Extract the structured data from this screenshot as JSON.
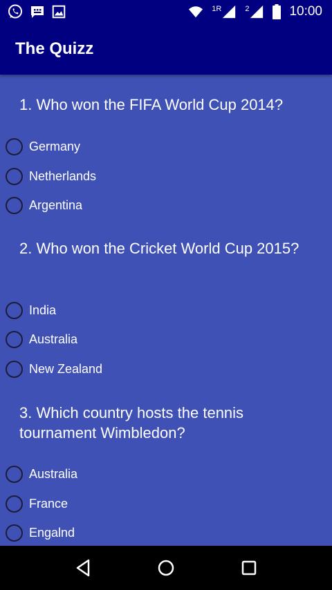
{
  "status_bar": {
    "sim1_label": "1",
    "sim1_roaming": "R",
    "sim2_label": "2",
    "time": "10:00",
    "icons": [
      "whatsapp-icon",
      "message-icon",
      "gallery-icon",
      "wifi-icon",
      "signal-icon",
      "battery-icon"
    ]
  },
  "app_bar": {
    "title": "The Quizz"
  },
  "questions": [
    {
      "text": "1. Who won the FIFA World Cup 2014?",
      "options": [
        "Germany",
        "Netherlands",
        "Argentina"
      ]
    },
    {
      "text": "2. Who won the Cricket World Cup 2015?",
      "options": [
        "India",
        "Australia",
        "New Zealand"
      ]
    },
    {
      "text": "3. Which country hosts the tennis tournament Wimbledon?",
      "options": [
        "Australia",
        "France",
        "Engalnd"
      ]
    }
  ],
  "nav_bar": {
    "icons": [
      "back-icon",
      "home-icon",
      "recents-icon"
    ]
  },
  "colors": {
    "background": "#3f51b5",
    "app_bar": "#000080",
    "text": "#ffffff"
  }
}
